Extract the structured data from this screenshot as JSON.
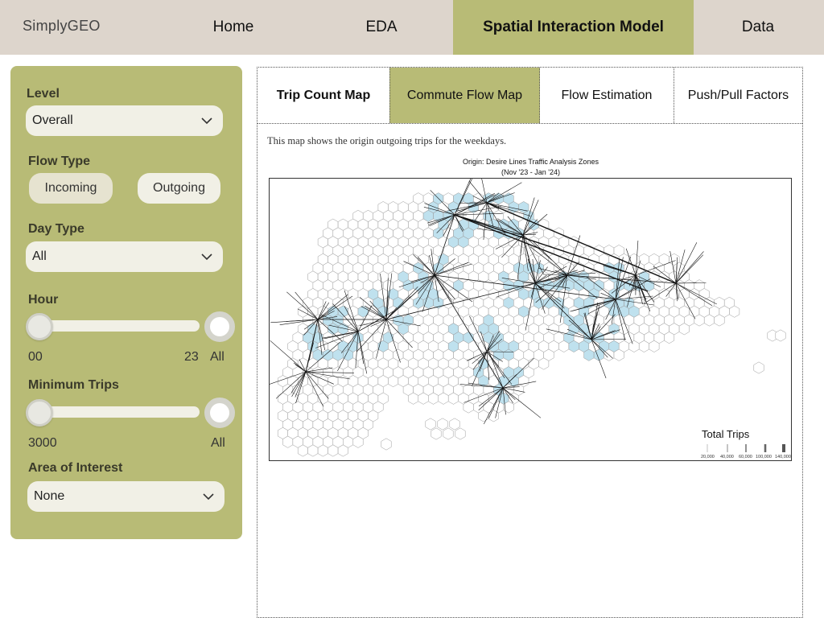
{
  "app": {
    "brand": "SimplyGEO"
  },
  "nav": {
    "home": "Home",
    "eda": "EDA",
    "sim": "Spatial Interaction Model",
    "data": "Data"
  },
  "sidebar": {
    "level_label": "Level",
    "level_value": "Overall",
    "flow_type_label": "Flow Type",
    "flow_incoming": "Incoming",
    "flow_outgoing": "Outgoing",
    "flow_selected": "Incoming",
    "day_type_label": "Day Type",
    "day_type_value": "All",
    "hour_label": "Hour",
    "hour_min": "00",
    "hour_max": "23",
    "hour_all": "All",
    "min_trips_label": "Minimum Trips",
    "min_trips_value": "3000",
    "min_trips_all": "All",
    "aoi_label": "Area of Interest",
    "aoi_value": "None"
  },
  "tabs": {
    "trip_count": "Trip Count Map",
    "commute_flow": "Commute Flow Map",
    "flow_estimation": "Flow Estimation",
    "push_pull": "Push/Pull Factors",
    "active": "Commute Flow Map"
  },
  "content": {
    "description": "This map shows the origin outgoing trips for the weekdays.",
    "map_title": "Origin: Desire Lines Traffic Analysis Zones",
    "map_subtitle": "(Nov '23 - Jan '24)",
    "legend_title": "Total Trips",
    "legend_ticks": [
      "20,000",
      "40,000",
      "60,000",
      "100,000",
      "140,000"
    ]
  },
  "colors": {
    "accent": "#b8bb76",
    "nav_bg": "#ddd5cc",
    "hex_fill": "#bfe1ee"
  }
}
